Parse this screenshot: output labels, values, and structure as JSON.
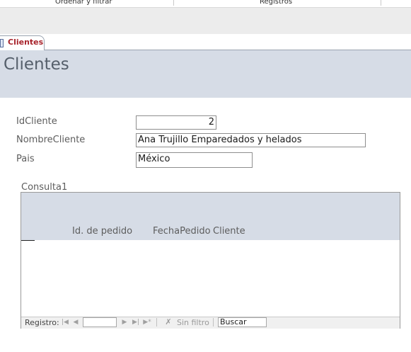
{
  "ribbon": {
    "groups": [
      {
        "label": "Ordenar y filtrar"
      },
      {
        "label": "Registros"
      }
    ]
  },
  "document_tab": {
    "label": "Clientes",
    "icon": "form-icon"
  },
  "form": {
    "title": "Clientes",
    "fields": {
      "id": {
        "label": "IdCliente",
        "value": "2"
      },
      "name": {
        "label": "NombreCliente",
        "value": "Ana Trujillo Emparedados y helados"
      },
      "country": {
        "label": "Pais",
        "value": "México"
      }
    }
  },
  "subform": {
    "label": "Consulta1",
    "columns": [
      "Id. de pedido",
      "FechaPedido",
      "Cliente"
    ],
    "rows": []
  },
  "navigation": {
    "record_label": "Registro:",
    "record_value": "",
    "first_icon": "first-record-icon",
    "prev_icon": "previous-record-icon",
    "next_icon": "next-record-icon",
    "last_icon": "last-record-icon",
    "new_icon": "new-record-icon",
    "filter_label": "Sin filtro",
    "filter_icon": "no-filter-icon",
    "search_value": "Buscar"
  },
  "colors": {
    "header_band": "#d6dce6",
    "tab_text": "#a8242c",
    "title_text": "#555f6b"
  }
}
